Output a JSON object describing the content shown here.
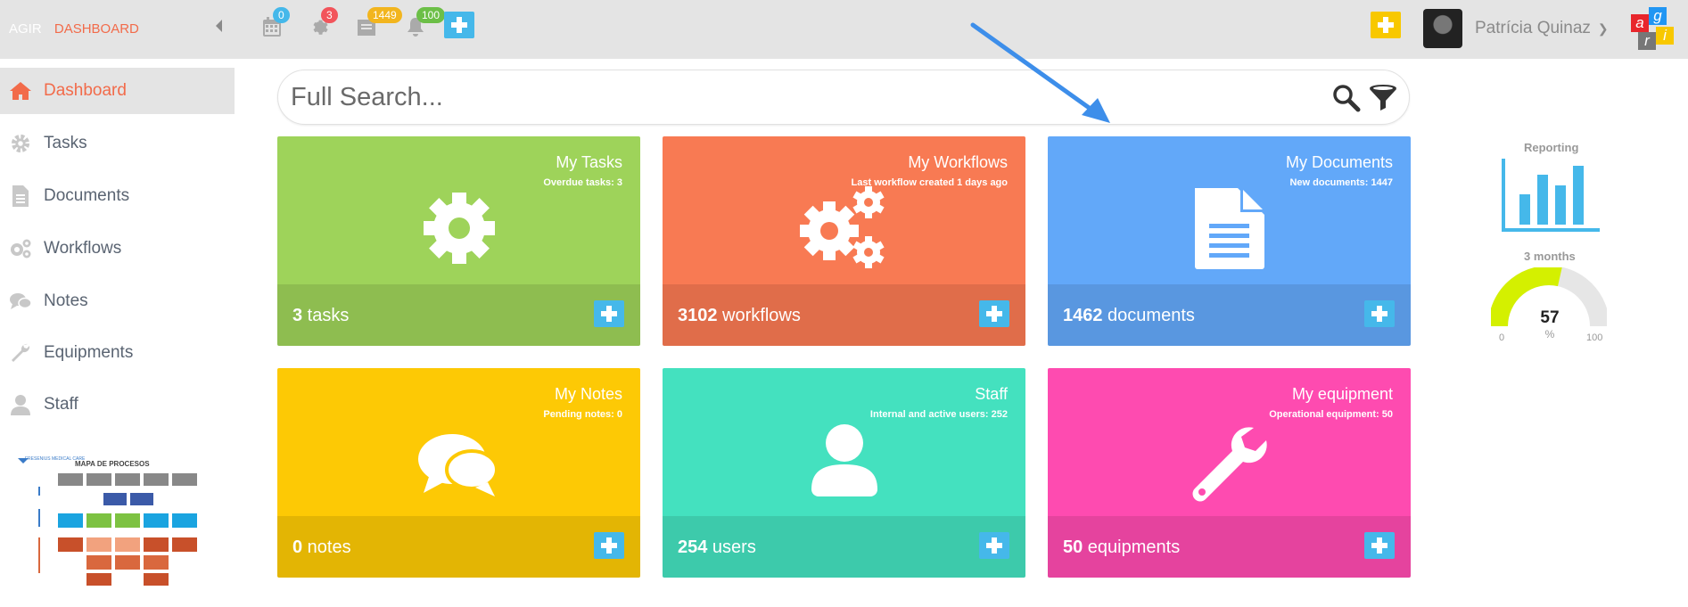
{
  "header": {
    "app_name": "AGIR",
    "section": "DASHBOARD",
    "badges": {
      "calendar": "0",
      "settings": "3",
      "documents": "1449",
      "notifications": "100"
    },
    "user_name": "Patrícia Quinaz",
    "logo_letters": [
      "a",
      "g",
      "r",
      "i"
    ]
  },
  "sidebar": {
    "items": [
      {
        "label": "Dashboard",
        "icon": "home-icon"
      },
      {
        "label": "Tasks",
        "icon": "gear-icon"
      },
      {
        "label": "Documents",
        "icon": "document-icon"
      },
      {
        "label": "Workflows",
        "icon": "gears-icon"
      },
      {
        "label": "Notes",
        "icon": "chat-icon"
      },
      {
        "label": "Equipments",
        "icon": "wrench-icon"
      },
      {
        "label": "Staff",
        "icon": "user-icon"
      }
    ],
    "process_map": {
      "company": "FRESENIUS MEDICAL CARE",
      "title": "MAPA DE PROCESOS"
    }
  },
  "search": {
    "placeholder": "Full Search..."
  },
  "cards": [
    {
      "title": "My Tasks",
      "subtitle": "Overdue tasks: 3",
      "count": "3",
      "unit": " tasks",
      "color": "#9ed35a",
      "footer_color": "#8ebd50",
      "icon": "gear-icon"
    },
    {
      "title": "My Workflows",
      "subtitle": "Last workflow created 1 days ago",
      "count": "3102",
      "unit": " workflows",
      "color": "#f87a53",
      "footer_color": "#e06d4a",
      "icon": "gears-icon"
    },
    {
      "title": "My Documents",
      "subtitle": "New documents: 1447",
      "count": "1462",
      "unit": " documents",
      "color": "#62a8f9",
      "footer_color": "#5997e0",
      "icon": "document-icon"
    },
    {
      "title": "My Notes",
      "subtitle": "Pending notes: 0",
      "count": "0",
      "unit": " notes",
      "color": "#fdc905",
      "footer_color": "#e3b504",
      "icon": "chat-icon"
    },
    {
      "title": "Staff",
      "subtitle": "Internal and active users: 252",
      "count": "254",
      "unit": " users",
      "color": "#44e1bf",
      "footer_color": "#3dcaab",
      "icon": "user-icon"
    },
    {
      "title": "My equipment",
      "subtitle": "Operational equipment: 50",
      "count": "50",
      "unit": " equipments",
      "color": "#fe4bb0",
      "footer_color": "#e5439e",
      "icon": "wrench-icon"
    }
  ],
  "reporting": {
    "label": "Reporting",
    "period": "3 months",
    "gauge_value": "57",
    "gauge_unit": "%",
    "gauge_min": "0",
    "gauge_max": "100",
    "gauge_fraction": 0.57
  },
  "colors": {
    "accent": "#f26b4a",
    "plus_blue": "#45b8ea",
    "plus_yellow": "#f8c800",
    "gauge_fill": "#d4f000"
  }
}
